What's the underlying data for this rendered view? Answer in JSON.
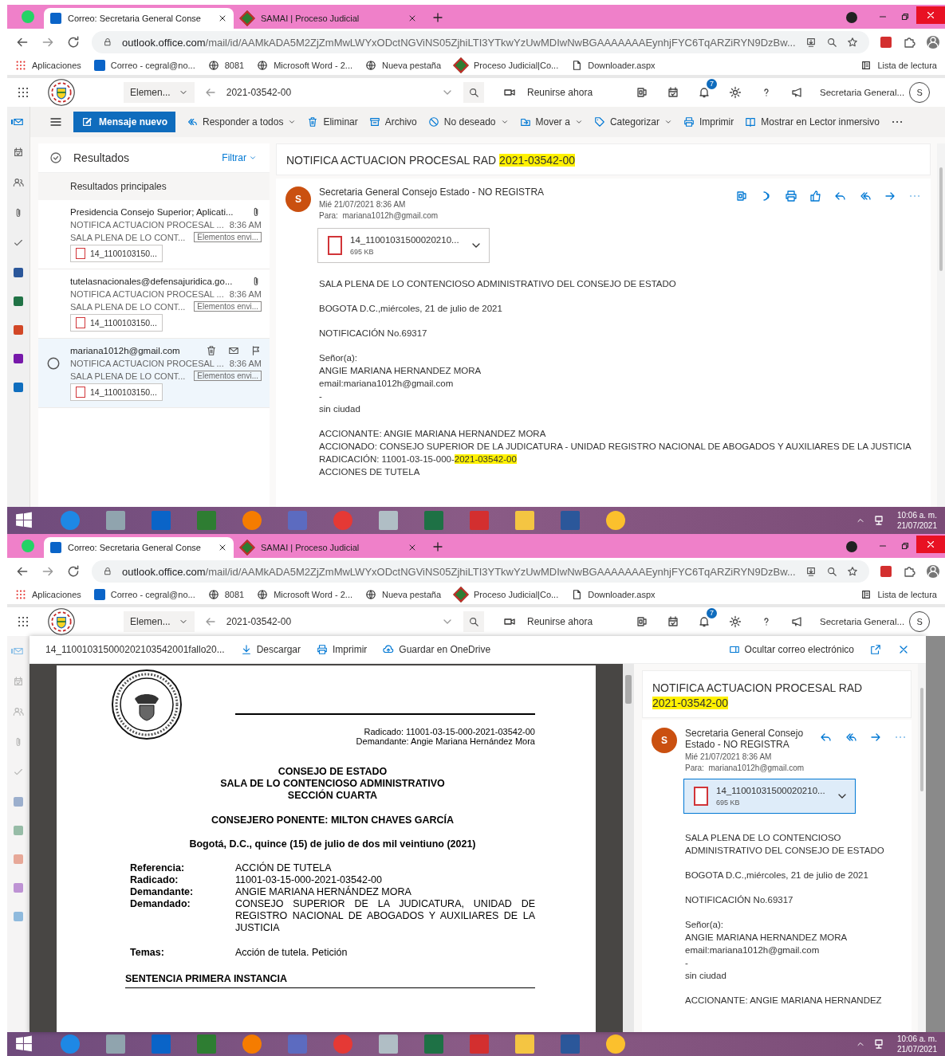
{
  "screens": [
    {
      "kind": "mail",
      "browser": {
        "tabs": [
          {
            "title": "Correo: Secretaria General Conse",
            "selected": true
          },
          {
            "title": "SAMAI | Proceso Judicial",
            "selected": false
          }
        ],
        "url_host": "outlook.office.com",
        "url_path": "/mail/id/AAMkADA5M2ZjZmMwLWYxODctNGViNS05ZjhiLTI3YTkwYzUwMDIwNwBGAAAAAAAEynhjFYC6TqARZiRYN9DzBw...",
        "bookmarks": [
          "Aplicaciones",
          "Correo - cegral@no...",
          "8081",
          "Microsoft Word - 2...",
          "Nueva pestaña",
          "Proceso Judicial|Co...",
          "Downloader.aspx"
        ],
        "reading_list": "Lista de lectura"
      },
      "header": {
        "scope": "Elemen...",
        "query": "2021-03542-00",
        "meet": "Reunirse ahora",
        "notifications": "7",
        "account": "Secretaria General...",
        "avatar": "S"
      },
      "toolbar": {
        "new_message": "Mensaje nuevo",
        "actions": [
          {
            "label": "Responder a todos",
            "dropdown": true
          },
          {
            "label": "Eliminar",
            "dropdown": false
          },
          {
            "label": "Archivo",
            "dropdown": false
          },
          {
            "label": "No deseado",
            "dropdown": true
          },
          {
            "label": "Mover a",
            "dropdown": true
          },
          {
            "label": "Categorizar",
            "dropdown": true
          },
          {
            "label": "Imprimir",
            "dropdown": false
          },
          {
            "label": "Mostrar en Lector inmersivo",
            "dropdown": false
          }
        ]
      },
      "list": {
        "title": "Resultados",
        "filter": "Filtrar",
        "section": "Resultados principales"
      },
      "messages": [
        {
          "from": "Presidencia Consejo Superior; Aplicati...",
          "subject": "NOTIFICA ACTUACION PROCESAL ...",
          "time": "8:36 AM",
          "preview": "SALA PLENA DE LO CONT...",
          "folder": "Elementos envi...",
          "attachment": "14_1100103150...",
          "selected": false
        },
        {
          "from": "tutelasnacionales@defensajuridica.go...",
          "subject": "NOTIFICA ACTUACION PROCESAL ...",
          "time": "8:36 AM",
          "preview": "SALA PLENA DE LO CONT...",
          "folder": "Elementos envi...",
          "attachment": "14_1100103150...",
          "selected": false
        },
        {
          "from": "mariana1012h@gmail.com",
          "subject": "NOTIFICA ACTUACION PROCESAL ...",
          "time": "8:36 AM",
          "preview": "SALA PLENA DE LO CONT...",
          "folder": "Elementos envi...",
          "attachment": "14_1100103150...",
          "selected": true
        }
      ],
      "reading": {
        "subject": [
          {
            "text": "NOTIFICA ACTUACION PROCESAL RAD ",
            "highlight": false
          },
          {
            "text": "2021-03542-00",
            "highlight": true
          }
        ],
        "avatar": "S",
        "sender": "Secretaria General Consejo Estado - NO REGISTRA",
        "date": "Mié 21/07/2021 8:36 AM",
        "to_label": "Para:",
        "to": "mariana1012h@gmail.com",
        "attachment": {
          "name": "14_11001031500020210...",
          "size": "695 KB",
          "selected": false
        },
        "body": [
          [
            "SALA PLENA DE LO CONTENCIOSO ADMINISTRATIVO DEL CONSEJO DE ESTADO"
          ],
          [
            "BOGOTA D.C.,miércoles, 21 de julio de 2021"
          ],
          [
            "NOTIFICACIÓN No.69317"
          ],
          [
            "Señor(a):",
            "ANGIE MARIANA HERNANDEZ MORA",
            "email:mariana1012h@gmail.com",
            "-",
            "sin ciudad"
          ],
          [
            "ACCIONANTE: ANGIE MARIANA HERNANDEZ MORA",
            "ACCIONADO: CONSEJO SUPERIOR DE LA JUDICATURA - UNIDAD REGISTRO NACIONAL DE ABOGADOS Y AUXILIARES DE LA JUSTICIA",
            {
              "parts": [
                {
                  "text": "RADICACIÓN: 11001-03-15-000-",
                  "highlight": false
                },
                {
                  "text": "2021-03542-00",
                  "highlight": true
                }
              ]
            },
            "ACCIONES DE TUTELA"
          ]
        ]
      },
      "taskbar": {
        "time": "10:06 a. m.",
        "date": "21/07/2021"
      }
    },
    {
      "kind": "viewer",
      "browser": {
        "tabs": [
          {
            "title": "Correo: Secretaria General Conse",
            "selected": true
          },
          {
            "title": "SAMAI | Proceso Judicial",
            "selected": false
          }
        ],
        "url_host": "outlook.office.com",
        "url_path": "/mail/id/AAMkADA5M2ZjZmMwLWYxODctNGViNS05ZjhiLTI3YTkwYzUwMDIwNwBGAAAAAAAEynhjFYC6TqARZiRYN9DzBw...",
        "bookmarks": [
          "Aplicaciones",
          "Correo - cegral@no...",
          "8081",
          "Microsoft Word - 2...",
          "Nueva pestaña",
          "Proceso Judicial|Co...",
          "Downloader.aspx"
        ],
        "reading_list": "Lista de lectura"
      },
      "header": {
        "scope": "Elemen...",
        "query": "2021-03542-00",
        "meet": "Reunirse ahora",
        "notifications": "7",
        "account": "Secretaria General...",
        "avatar": "S"
      },
      "viewer": {
        "file": "14_110010315000202103542001fallo20...",
        "actions": [
          "Descargar",
          "Imprimir",
          "Guardar en OneDrive"
        ],
        "hide_mail": "Ocultar correo electrónico"
      },
      "document": {
        "header_lines": [
          "Radicado: 11001-03-15-000-2021-03542-00",
          "Demandante: Angie Mariana Hernández Mora"
        ],
        "titles": [
          "CONSEJO DE ESTADO",
          "SALA DE LO CONTENCIOSO ADMINISTRATIVO",
          "SECCIÓN CUARTA"
        ],
        "ponente": "CONSEJERO PONENTE: MILTON CHAVES GARCÍA",
        "date": "Bogotá, D.C., quince (15) de julio de dos mil veintiuno (2021)",
        "fields": [
          {
            "label": "Referencia:",
            "value": "ACCIÓN DE TUTELA"
          },
          {
            "label": "Radicado:",
            "value": "11001-03-15-000-2021-03542-00"
          },
          {
            "label": "Demandante:",
            "value": "ANGIE MARIANA HERNÁNDEZ MORA"
          },
          {
            "label": "Demandado:",
            "value": "CONSEJO SUPERIOR DE LA JUDICATURA, UNIDAD DE REGISTRO NACIONAL DE ABOGADOS Y AUXILIARES DE LA JUSTICIA"
          }
        ],
        "topics": {
          "label": "Temas:",
          "value": "Acción de tutela. Petición"
        },
        "section": "SENTENCIA PRIMERA INSTANCIA"
      },
      "reading": {
        "subject": [
          {
            "text": "NOTIFICA ACTUACION PROCESAL RAD ",
            "highlight": false
          },
          {
            "text": "2021-03542-00",
            "highlight": true
          }
        ],
        "avatar": "S",
        "sender": "Secretaria General Consejo Estado - NO REGISTRA",
        "date": "Mié 21/07/2021 8:36 AM",
        "to_label": "Para:",
        "to": "mariana1012h@gmail.com",
        "attachment": {
          "name": "14_11001031500020210...",
          "size": "695 KB",
          "selected": true
        },
        "body": [
          [
            "SALA PLENA DE LO CONTENCIOSO ADMINISTRATIVO DEL CONSEJO DE ESTADO"
          ],
          [
            "BOGOTA D.C.,miércoles, 21 de julio de 2021"
          ],
          [
            "NOTIFICACIÓN No.69317"
          ],
          [
            "Señor(a):",
            "ANGIE MARIANA HERNANDEZ MORA",
            "email:mariana1012h@gmail.com",
            "-",
            "sin ciudad"
          ],
          [
            "ACCIONANTE: ANGIE MARIANA HERNANDEZ"
          ]
        ]
      },
      "taskbar": {
        "time": "10:06 a. m.",
        "date": "21/07/2021"
      }
    }
  ]
}
